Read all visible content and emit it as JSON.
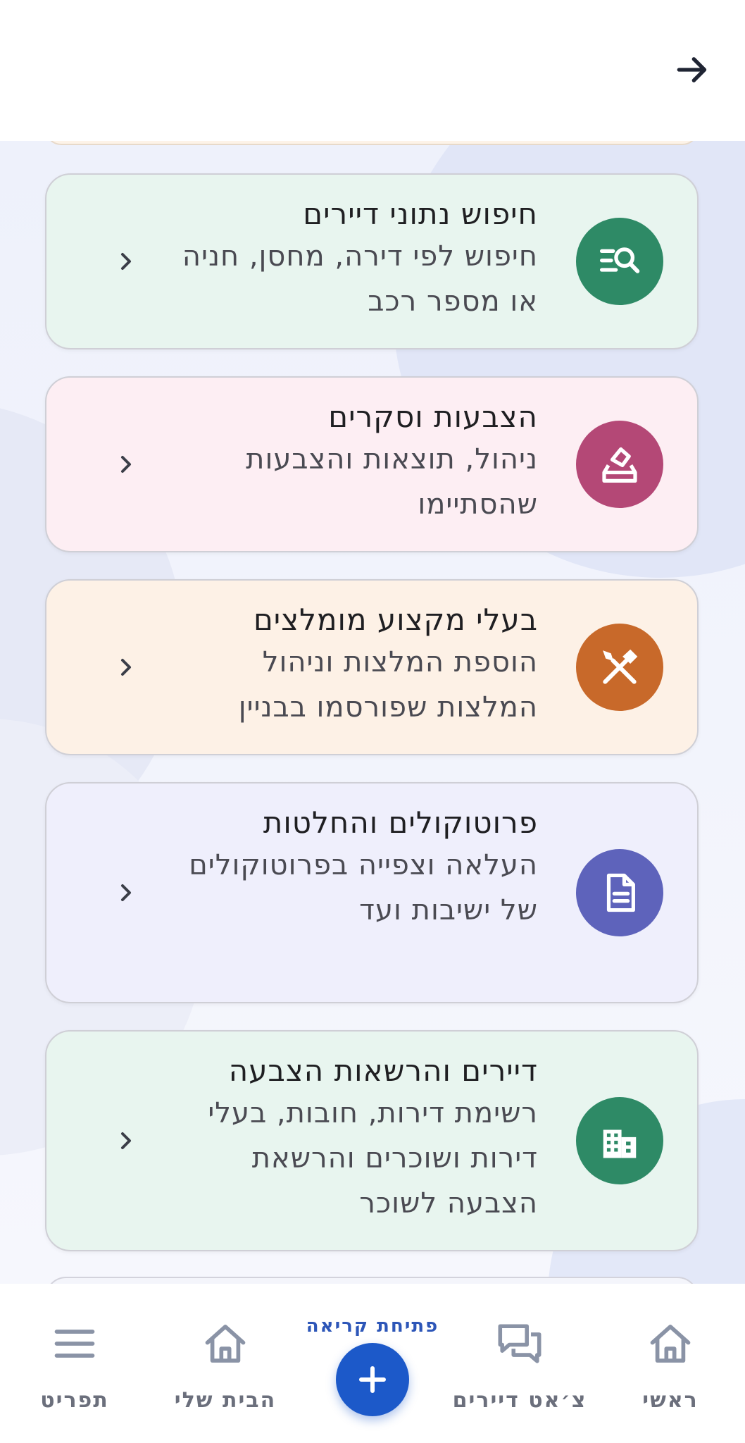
{
  "header": {
    "back_icon": "arrow-right-icon"
  },
  "cards": [
    {
      "title": "חיפוש נתוני דיירים",
      "description": "חיפוש לפי דירה, מחסן, חניה או מספר רכב",
      "icon": "search-list-icon",
      "bg_color": "#e8f5ef",
      "icon_color": "#2e8a66"
    },
    {
      "title": "הצבעות וסקרים",
      "description": "ניהול, תוצאות והצבעות שהסתיימו",
      "icon": "ballot-icon",
      "bg_color": "#fdeef3",
      "icon_color": "#b44876"
    },
    {
      "title": "בעלי מקצוע מומלצים",
      "description": "הוספת המלצות וניהול המלצות שפורסמו בבניין",
      "icon": "tools-icon",
      "bg_color": "#fdf1e6",
      "icon_color": "#c8692a"
    },
    {
      "title": "פרוטוקולים והחלטות",
      "description": "העלאה וצפייה בפרוטוקולים של ישיבות ועד",
      "icon": "document-icon",
      "bg_color": "#efeffc",
      "icon_color": "#5e63bb"
    },
    {
      "title": "דיירים והרשאות הצבעה",
      "description": "רשימת דירות, חובות, בעלי דירות ושוכרים והרשאת הצבעה לשוכר",
      "icon": "building-icon",
      "bg_color": "#e8f5ef",
      "icon_color": "#2e8a66"
    }
  ],
  "nav": {
    "home": "ראשי",
    "chat": "צ׳אט דיירים",
    "open_ticket": "פתיחת קריאה",
    "my_home": "הבית שלי",
    "menu": "תפריט"
  }
}
